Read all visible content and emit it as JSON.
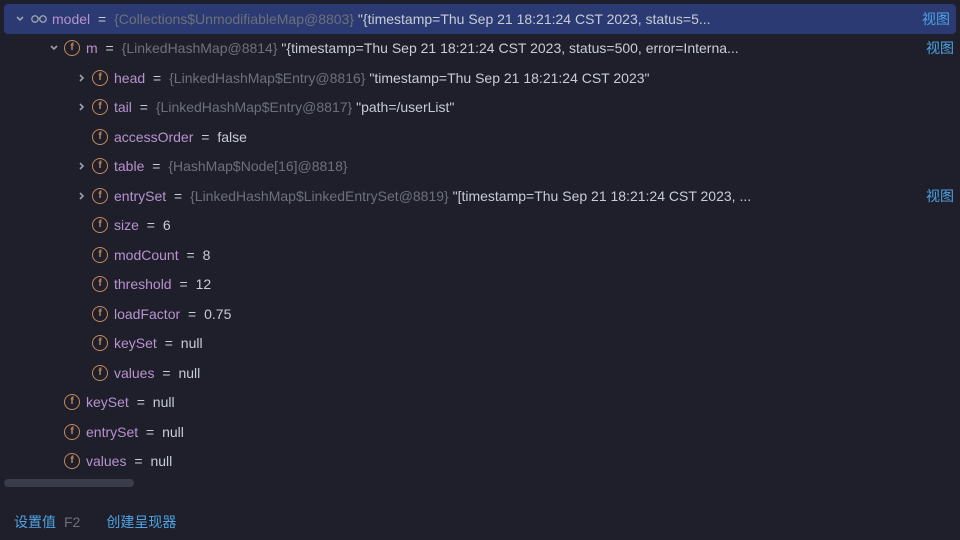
{
  "icons": {
    "field_letter": "f"
  },
  "view_link": "视图",
  "rows": [
    {
      "indent": 8,
      "chev": "down",
      "pre": "glasses",
      "name": "model",
      "eq": " = ",
      "type": "{Collections$UnmodifiableMap@8803} ",
      "val": "\"{timestamp=Thu Sep 21 18:21:24 CST 2023, status=5",
      "ell": "...",
      "link": true,
      "selected": true
    },
    {
      "indent": 46,
      "chev": "down",
      "pre": "field",
      "name": "m",
      "eq": " = ",
      "type": "{LinkedHashMap@8814} ",
      "val": "\"{timestamp=Thu Sep 21 18:21:24 CST 2023, status=500, error=Interna",
      "ell": "...",
      "link": true
    },
    {
      "indent": 74,
      "chev": "right",
      "pre": "field",
      "name": "head",
      "eq": " = ",
      "type": "{LinkedHashMap$Entry@8816} ",
      "val": "\"timestamp=Thu Sep 21 18:21:24 CST 2023\""
    },
    {
      "indent": 74,
      "chev": "right",
      "pre": "field",
      "name": "tail",
      "eq": " = ",
      "type": "{LinkedHashMap$Entry@8817} ",
      "val": "\"path=/userList\""
    },
    {
      "indent": 74,
      "chev": "blank",
      "pre": "field",
      "name": "accessOrder",
      "eq": " = ",
      "type": "",
      "val": "false"
    },
    {
      "indent": 74,
      "chev": "right",
      "pre": "field",
      "name": "table",
      "eq": " = ",
      "type": "{HashMap$Node[16]@8818}",
      "val": ""
    },
    {
      "indent": 74,
      "chev": "right",
      "pre": "field",
      "name": "entrySet",
      "eq": " = ",
      "type": "{LinkedHashMap$LinkedEntrySet@8819} ",
      "val": "\"[timestamp=Thu Sep 21 18:21:24 CST 2023, ",
      "ell": "...",
      "link": true
    },
    {
      "indent": 74,
      "chev": "blank",
      "pre": "field",
      "name": "size",
      "eq": " = ",
      "type": "",
      "val": "6"
    },
    {
      "indent": 74,
      "chev": "blank",
      "pre": "field",
      "name": "modCount",
      "eq": " = ",
      "type": "",
      "val": "8"
    },
    {
      "indent": 74,
      "chev": "blank",
      "pre": "field",
      "name": "threshold",
      "eq": " = ",
      "type": "",
      "val": "12"
    },
    {
      "indent": 74,
      "chev": "blank",
      "pre": "field",
      "name": "loadFactor",
      "eq": " = ",
      "type": "",
      "val": "0.75"
    },
    {
      "indent": 74,
      "chev": "blank",
      "pre": "field",
      "name": "keySet",
      "eq": " = ",
      "type": "",
      "val": "null"
    },
    {
      "indent": 74,
      "chev": "blank",
      "pre": "field",
      "name": "values",
      "eq": " = ",
      "type": "",
      "val": "null"
    },
    {
      "indent": 46,
      "chev": "blank",
      "pre": "field",
      "name": "keySet",
      "eq": " = ",
      "type": "",
      "val": "null"
    },
    {
      "indent": 46,
      "chev": "blank",
      "pre": "field",
      "name": "entrySet",
      "eq": " = ",
      "type": "",
      "val": "null"
    },
    {
      "indent": 46,
      "chev": "blank",
      "pre": "field",
      "name": "values",
      "eq": " = ",
      "type": "",
      "val": "null"
    }
  ],
  "footer": {
    "set_value": "设置值",
    "set_value_key": "F2",
    "create_renderer": "创建呈现器"
  }
}
